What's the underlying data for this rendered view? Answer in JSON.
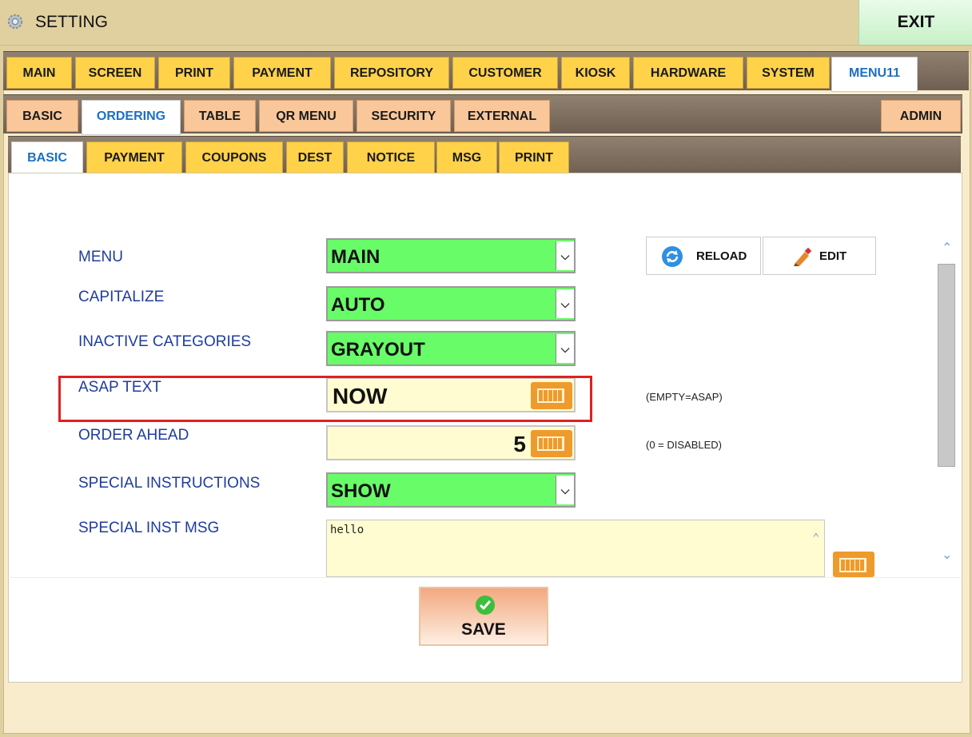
{
  "window": {
    "title": "SETTING",
    "exit_label": "EXIT"
  },
  "tabs_level1": [
    {
      "label": "MAIN"
    },
    {
      "label": "SCREEN"
    },
    {
      "label": "PRINT"
    },
    {
      "label": "PAYMENT"
    },
    {
      "label": "REPOSITORY"
    },
    {
      "label": "CUSTOMER"
    },
    {
      "label": "KIOSK"
    },
    {
      "label": "HARDWARE"
    },
    {
      "label": "SYSTEM"
    },
    {
      "label": "MENU11",
      "active": true
    }
  ],
  "tabs_level2": [
    {
      "label": "BASIC"
    },
    {
      "label": "ORDERING",
      "active": true
    },
    {
      "label": "TABLE"
    },
    {
      "label": "QR MENU"
    },
    {
      "label": "SECURITY"
    },
    {
      "label": "EXTERNAL"
    },
    {
      "label": "ADMIN"
    }
  ],
  "tabs_level3": [
    {
      "label": "BASIC",
      "active": true
    },
    {
      "label": "PAYMENT"
    },
    {
      "label": "COUPONS"
    },
    {
      "label": "DEST"
    },
    {
      "label": "NOTICE"
    },
    {
      "label": "MSG"
    },
    {
      "label": "PRINT"
    }
  ],
  "form": {
    "menu": {
      "label": "MENU",
      "value": "MAIN"
    },
    "capitalize": {
      "label": "CAPITALIZE",
      "value": "AUTO"
    },
    "inactive_categories": {
      "label": "INACTIVE CATEGORIES",
      "value": "GRAYOUT"
    },
    "asap_text": {
      "label": "ASAP TEXT",
      "value": "NOW",
      "hint": "(EMPTY=ASAP)"
    },
    "order_ahead": {
      "label": "ORDER AHEAD",
      "value": "5",
      "hint": "(0 = DISABLED)"
    },
    "special_instructions": {
      "label": "SPECIAL INSTRUCTIONS",
      "value": "SHOW"
    },
    "special_inst_msg": {
      "label": "SPECIAL INST MSG",
      "value": "hello"
    }
  },
  "buttons": {
    "reload": "RELOAD",
    "edit": "EDIT",
    "save": "SAVE"
  },
  "colors": {
    "select_green": "#68fc68",
    "field_yellow": "#fefcd0",
    "tab_yellow": "#ffd24a",
    "tab_peach": "#f9c79a",
    "active_tab_text": "#1c6fc5",
    "highlight_red": "#e02020"
  }
}
